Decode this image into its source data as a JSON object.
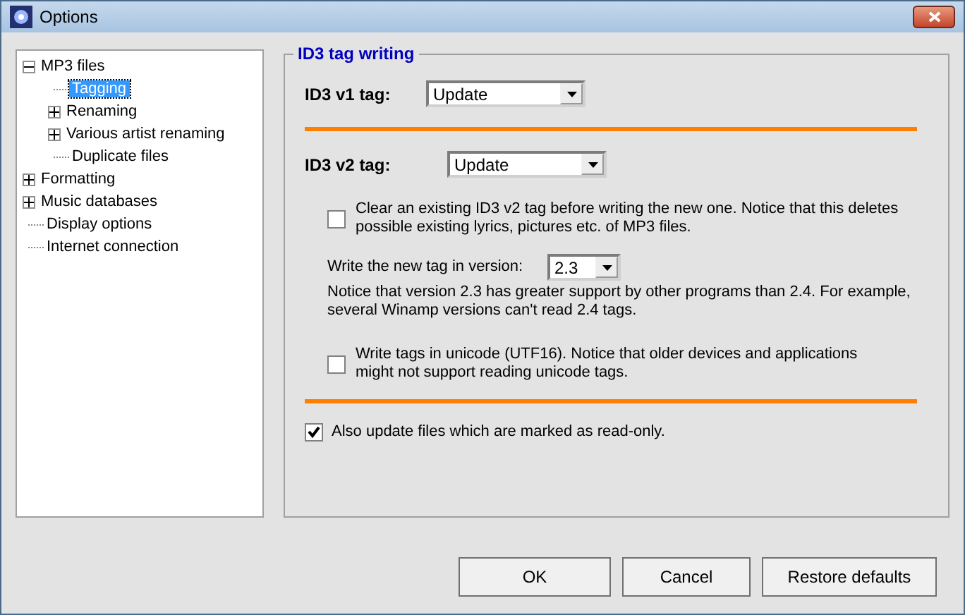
{
  "window": {
    "title": "Options"
  },
  "tree": [
    {
      "label": "MP3 files",
      "selected": false,
      "expanded": true,
      "children": [
        {
          "label": "Tagging",
          "selected": true
        },
        {
          "label": "Renaming",
          "selected": false,
          "expanded": false
        },
        {
          "label": "Various artist renaming",
          "selected": false,
          "expanded": false
        },
        {
          "label": "Duplicate files",
          "selected": false
        }
      ]
    },
    {
      "label": "Formatting",
      "selected": false,
      "expanded": false
    },
    {
      "label": "Music databases",
      "selected": false,
      "expanded": false
    },
    {
      "label": "Display options",
      "selected": false
    },
    {
      "label": "Internet connection",
      "selected": false
    }
  ],
  "group": {
    "title": "ID3 tag writing",
    "v1": {
      "label": "ID3 v1 tag:",
      "value": "Update"
    },
    "v2": {
      "label": "ID3 v2 tag:",
      "value": "Update"
    },
    "clear": {
      "label": "Clear an existing ID3 v2 tag before writing the new one. Notice that this deletes possible existing lyrics, pictures etc. of MP3 files.",
      "checked": false
    },
    "version": {
      "label": "Write the new tag in version:",
      "value": "2.3",
      "note": "Notice that version 2.3 has greater support by other programs than 2.4. For example, several Winamp versions can't read 2.4 tags."
    },
    "unicode": {
      "label": "Write tags in unicode (UTF16). Notice that older devices and applications might not support reading unicode tags.",
      "checked": false
    },
    "readonly": {
      "label": "Also update files which are marked as read-only.",
      "checked": true
    }
  },
  "buttons": [
    "OK",
    "Cancel",
    "Restore defaults"
  ]
}
